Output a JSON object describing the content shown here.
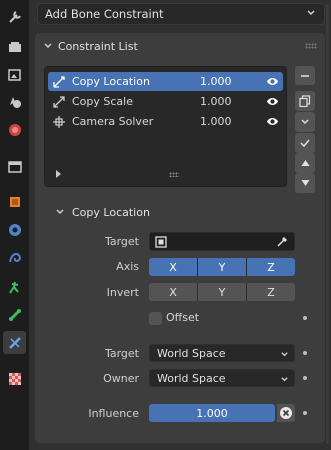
{
  "header": {
    "add_constraint_label": "Add Bone Constraint"
  },
  "constraint_list": {
    "title": "Constraint List",
    "items": [
      {
        "name": "Copy Location",
        "value": "1.000",
        "icon": "copy-location-icon",
        "selected": true
      },
      {
        "name": "Copy Scale",
        "value": "1.000",
        "icon": "copy-scale-icon",
        "selected": false
      },
      {
        "name": "Camera Solver",
        "value": "1.000",
        "icon": "camera-solver-icon",
        "selected": false
      }
    ]
  },
  "constraint": {
    "title": "Copy Location",
    "target_label": "Target",
    "target_value": "",
    "axis_label": "Axis",
    "axis": [
      "X",
      "Y",
      "Z"
    ],
    "invert_label": "Invert",
    "invert": [
      "X",
      "Y",
      "Z"
    ],
    "offset_label": "Offset",
    "target_space_label": "Target",
    "target_space_value": "World Space",
    "owner_space_label": "Owner",
    "owner_space_value": "World Space",
    "influence_label": "Influence",
    "influence_value": "1.000"
  },
  "colors": {
    "accent": "#4772b3",
    "panel": "#3d3d3d",
    "background": "#303030"
  }
}
